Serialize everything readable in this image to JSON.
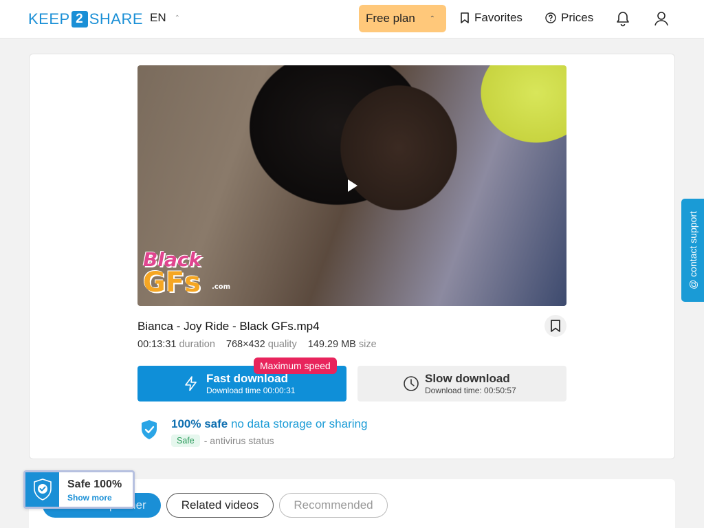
{
  "header": {
    "logo_left": "KEEP",
    "logo_mid": "2",
    "logo_right": "SHARE",
    "language": "EN",
    "plan_label": "Free plan",
    "favorites_label": "Favorites",
    "prices_label": "Prices"
  },
  "file": {
    "name": "Bianca - Joy Ride - Black GFs.mp4",
    "duration_value": "00:13:31",
    "duration_label": "duration",
    "quality_value": "768×432",
    "quality_label": "quality",
    "size_value": "149.29 MB",
    "size_label": "size"
  },
  "video": {
    "watermark_line1": "Black",
    "watermark_line2": "GFs",
    "watermark_domain": ".com"
  },
  "download": {
    "fast_title": "Fast download",
    "fast_subtitle": "Download time 00:00:31",
    "max_speed_badge": "Maximum speed",
    "slow_title": "Slow download",
    "slow_subtitle": "Download time: 00:50:57"
  },
  "safety": {
    "headline_bold": "100% safe",
    "headline_rest": "no data storage or sharing",
    "antivirus_badge": "Safe",
    "antivirus_label": "- antivirus status"
  },
  "support": {
    "label": "@ contact support"
  },
  "tabs": [
    {
      "label": "From this partner",
      "active": true
    },
    {
      "label": "Related videos",
      "active": false
    },
    {
      "label": "Recommended",
      "active": false
    }
  ],
  "safe_badge": {
    "title": "Safe 100%",
    "link": "Show more"
  },
  "colors": {
    "primary": "#1a8fd6",
    "plan_bg": "#ffc87a",
    "max_speed_bg": "#e8245c",
    "safe_green": "#2a9a5a"
  },
  "icons": [
    "bookmark-icon",
    "question-circle-icon",
    "bell-icon",
    "user-icon",
    "lightning-icon",
    "clock-icon",
    "shield-check-icon",
    "play-icon",
    "chevron-up-icon"
  ]
}
